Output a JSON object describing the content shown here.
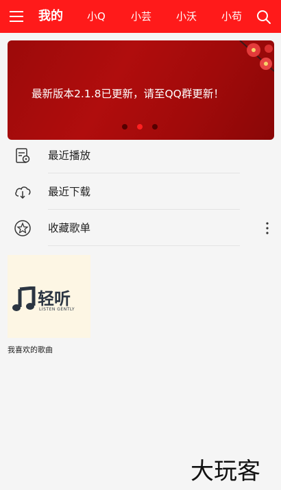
{
  "header": {
    "tabs": [
      {
        "label": "我的"
      },
      {
        "label": "小Q"
      },
      {
        "label": "小芸"
      },
      {
        "label": "小沃"
      },
      {
        "label": "小苟"
      }
    ]
  },
  "banner": {
    "text": "最新版本2.1.8已更新，请至QQ群更新！",
    "page_count": 3,
    "active_page": 2
  },
  "menu": {
    "items": [
      {
        "label": "最近播放",
        "icon": "recent-play-icon"
      },
      {
        "label": "最近下载",
        "icon": "cloud-download-icon"
      },
      {
        "label": "收藏歌单",
        "icon": "star-icon"
      }
    ]
  },
  "playlists": [
    {
      "name": "我喜欢的歌曲",
      "cover_title": "轻听",
      "cover_subtitle": "LISTEN GENTLY"
    }
  ],
  "watermark": "大玩客",
  "colors": {
    "accent": "#ff1a1a",
    "banner": "#a50b0b",
    "background": "#f5f5f5"
  }
}
